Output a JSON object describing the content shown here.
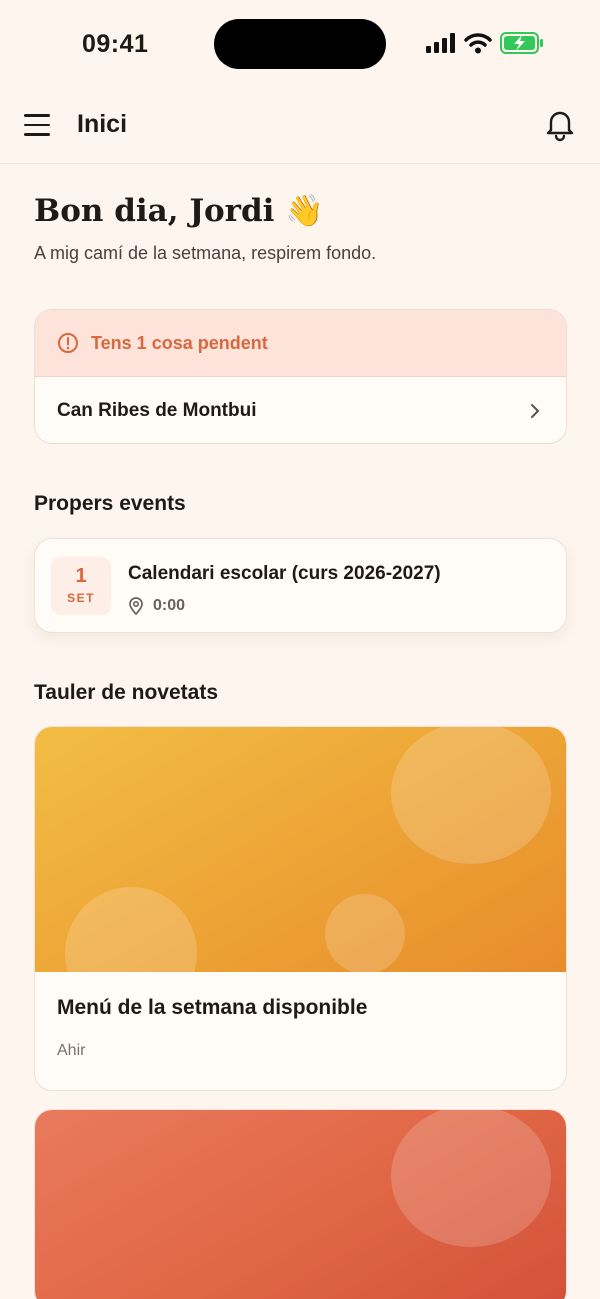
{
  "status_bar": {
    "time": "09:41"
  },
  "header": {
    "title": "Inici"
  },
  "greeting": {
    "title": "Bon dia, Jordi",
    "emoji": "👋",
    "subtitle": "A mig camí de la setmana, respirem fondo."
  },
  "pending": {
    "header_label": "Tens 1 cosa pendent",
    "items": [
      {
        "label": "Can Ribes de Montbui"
      }
    ]
  },
  "upcoming_events": {
    "title": "Propers events",
    "items": [
      {
        "day": "1",
        "month": "SET",
        "title": "Calendari escolar (curs 2026-2027)",
        "time": "0:00"
      }
    ]
  },
  "news_board": {
    "title": "Tauler de novetats",
    "items": [
      {
        "title": "Menú de la setmana disponible",
        "date": "Ahir",
        "color": "#eda335"
      },
      {
        "title": "",
        "date": "",
        "color": "#e06645"
      }
    ]
  },
  "colors": {
    "background": "#fdf5ee",
    "accent": "#d9683e",
    "pending_bg": "#fde3da",
    "battery_green": "#34c759"
  },
  "icons": [
    "menu-icon",
    "bell-icon",
    "alert-circle-icon",
    "chevron-right-icon",
    "location-pin-icon",
    "signal-icon",
    "wifi-icon",
    "battery-charging-icon"
  ]
}
